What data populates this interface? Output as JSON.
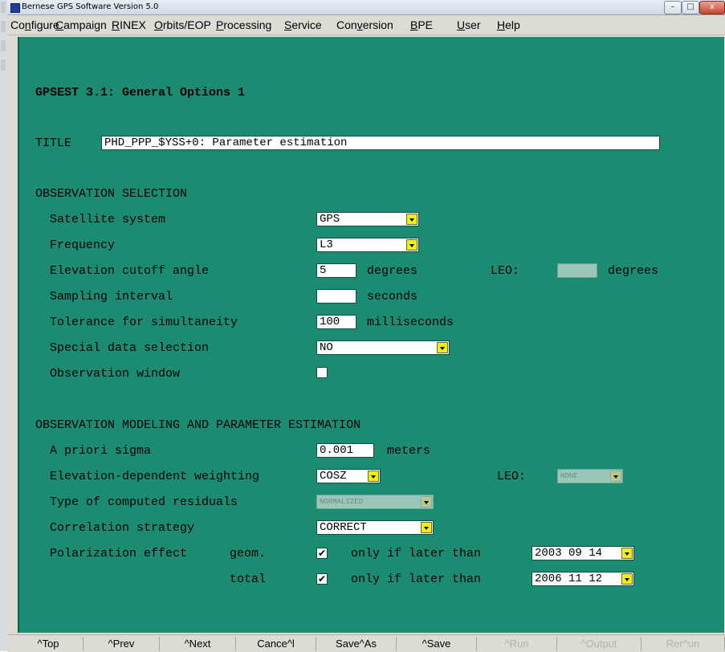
{
  "window": {
    "title": "Bernese GPS Software Version 5.0",
    "controls": [
      "minimize",
      "maximize",
      "close"
    ]
  },
  "menubar": [
    {
      "label": "Configure",
      "underline_index": 2
    },
    {
      "label": "Campaign",
      "underline_index": 0
    },
    {
      "label": "RINEX",
      "underline_index": 0
    },
    {
      "label": "Orbits/EOP",
      "underline_index": 0
    },
    {
      "label": "Processing",
      "underline_index": 0
    },
    {
      "label": "Service",
      "underline_index": 0
    },
    {
      "label": "Conversion",
      "underline_index": 3
    },
    {
      "label": "BPE",
      "underline_index": 0
    },
    {
      "label": "User",
      "underline_index": 0
    },
    {
      "label": "Help",
      "underline_index": 0
    }
  ],
  "panel": {
    "heading": "GPSEST 3.1: General Options 1",
    "title_label": "TITLE",
    "title_value": "PHD_PPP_$YSS+0: Parameter estimation",
    "obs_selection": {
      "section_title": "OBSERVATION SELECTION",
      "satellite_system": {
        "label": "Satellite system",
        "value": "GPS"
      },
      "frequency": {
        "label": "Frequency",
        "value": "L3"
      },
      "elevation_cutoff": {
        "label": "Elevation cutoff angle",
        "value": "5",
        "unit": "degrees",
        "leo_label": "LEO:",
        "leo_value": "",
        "leo_unit": "degrees"
      },
      "sampling_interval": {
        "label": "Sampling interval",
        "value": "",
        "unit": "seconds"
      },
      "tolerance": {
        "label": "Tolerance for simultaneity",
        "value": "100",
        "unit": "milliseconds"
      },
      "special_data": {
        "label": "Special data selection",
        "value": "NO"
      },
      "observation_window": {
        "label": "Observation window",
        "checked": false
      }
    },
    "obs_modeling": {
      "section_title": "OBSERVATION MODELING AND PARAMETER ESTIMATION",
      "a_priori_sigma": {
        "label": "A priori sigma",
        "value": "0.001",
        "unit": "meters"
      },
      "elev_weighting": {
        "label": "Elevation-dependent weighting",
        "value": "COSZ",
        "leo_label": "LEO:",
        "leo_value": "NONE"
      },
      "residuals": {
        "label": "Type of computed residuals",
        "value": "NORMALIZED"
      },
      "correlation": {
        "label": "Correlation strategy",
        "value": "CORRECT"
      },
      "polarization": {
        "label": "Polarization effect",
        "geom_label": "geom.",
        "total_label": "total",
        "only_if_later": "only if later than",
        "geom_checked": true,
        "total_checked": true,
        "geom_date": "2003 09 14",
        "total_date": "2006 11 12"
      }
    }
  },
  "bottombar": [
    {
      "label": "^Top",
      "enabled": true
    },
    {
      "label": "^Prev",
      "enabled": true
    },
    {
      "label": "^Next",
      "enabled": true
    },
    {
      "label": "Cance^l",
      "enabled": true
    },
    {
      "label": "Save^As",
      "enabled": true
    },
    {
      "label": "^Save",
      "enabled": true
    },
    {
      "label": "^Run",
      "enabled": false
    },
    {
      "label": "^Output",
      "enabled": false
    },
    {
      "label": "Rer^un",
      "enabled": false
    }
  ],
  "glyphs": {
    "check": "✔",
    "minimize": "–",
    "maximize": "□",
    "close": "x"
  }
}
